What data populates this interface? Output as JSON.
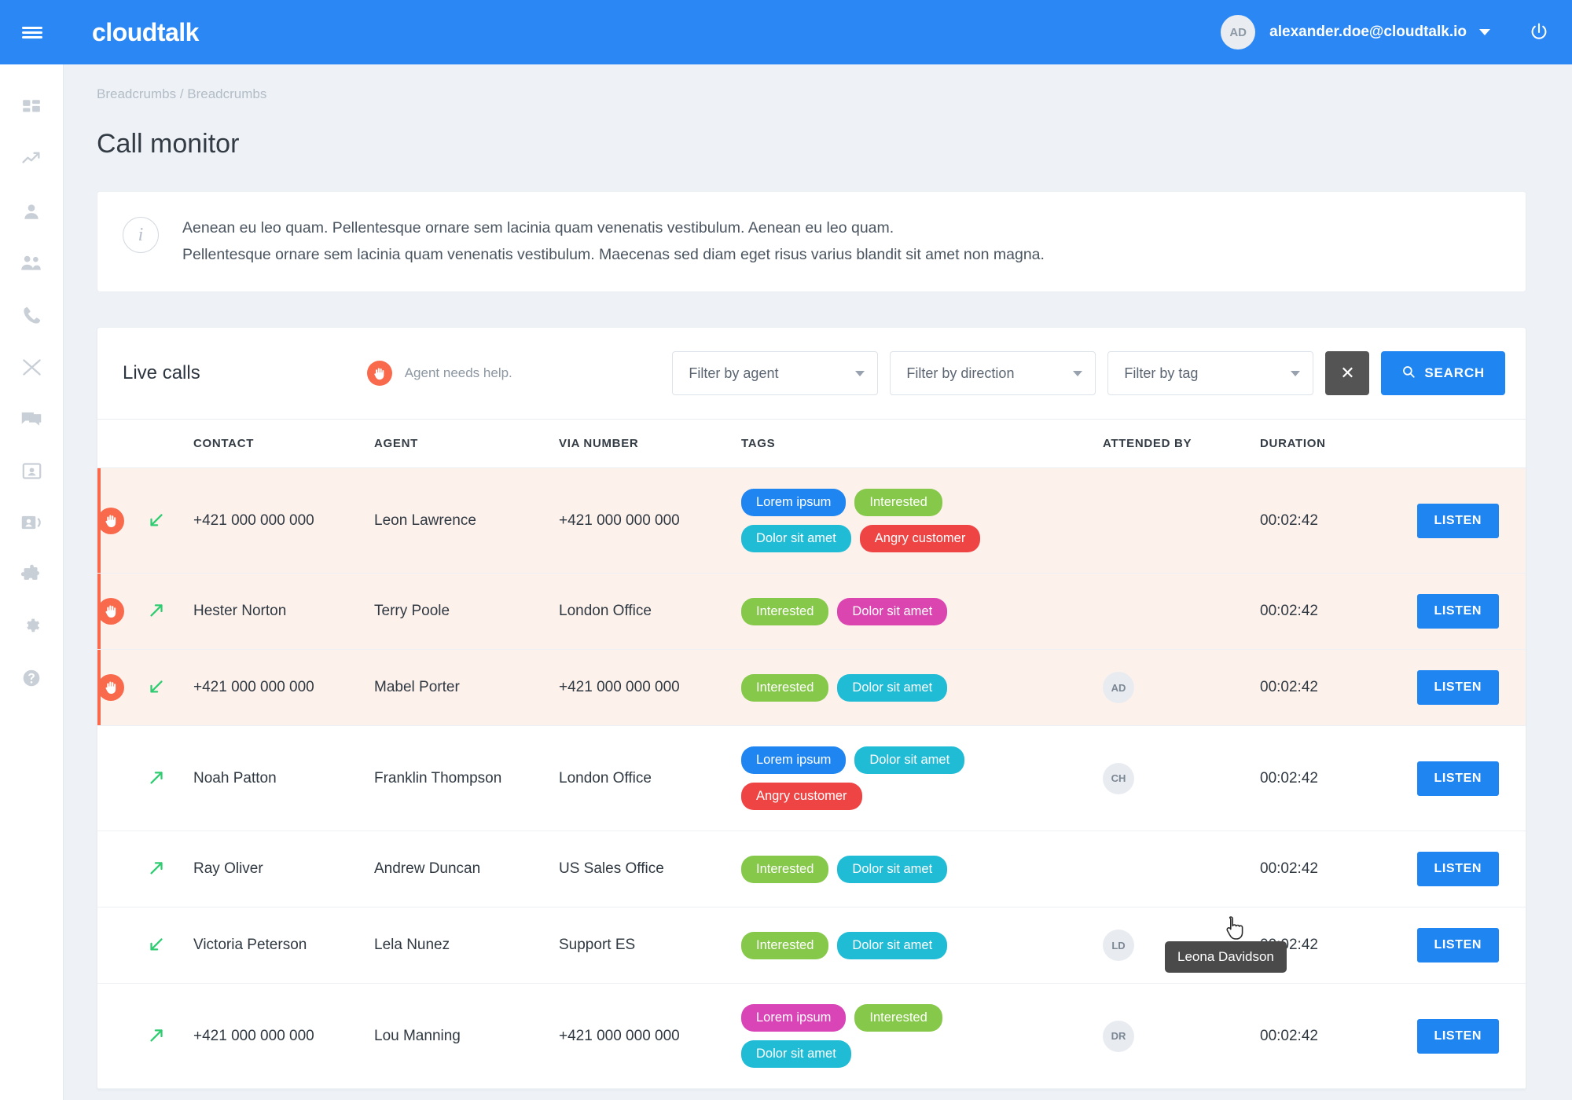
{
  "topbar": {
    "brand": "cloudtalk",
    "menu_icon": "hamburger-icon",
    "avatar_initials": "AD",
    "user_email": "alexander.doe@cloudtalk.io",
    "power_icon": "power-icon"
  },
  "sidebar": {
    "items": [
      {
        "name": "dashboard",
        "icon": "dashboard-icon"
      },
      {
        "name": "analytics",
        "icon": "trending-up-icon"
      },
      {
        "name": "agent",
        "icon": "person-icon"
      },
      {
        "name": "teams",
        "icon": "group-icon"
      },
      {
        "name": "calls",
        "icon": "phone-icon"
      },
      {
        "name": "routing",
        "icon": "shuffle-icon"
      },
      {
        "name": "messages",
        "icon": "chat-icon"
      },
      {
        "name": "contacts",
        "icon": "contact-card-icon"
      },
      {
        "name": "call-monitor",
        "icon": "id-card-icon"
      },
      {
        "name": "integrations",
        "icon": "puzzle-icon"
      },
      {
        "name": "settings",
        "icon": "gear-icon"
      },
      {
        "name": "help",
        "icon": "help-circle-icon"
      }
    ]
  },
  "breadcrumb": "Breadcrumbs / Breadcrumbs",
  "page_title": "Call monitor",
  "info_banner": {
    "icon": "info-icon",
    "line1": "Aenean eu leo quam. Pellentesque ornare sem lacinia quam venenatis vestibulum. Aenean eu leo quam.",
    "line2": "Pellentesque ornare sem lacinia quam venenatis vestibulum. Maecenas sed diam eget risus varius blandit sit amet non magna."
  },
  "toolbar": {
    "title": "Live calls",
    "help_icon": "raised-hand-icon",
    "help_text": "Agent needs help.",
    "filter_agent": "Filter by agent",
    "filter_direction": "Filter by direction",
    "filter_tag": "Filter by tag",
    "clear_label": "✕",
    "search_label": "SEARCH",
    "search_icon": "search-icon"
  },
  "table": {
    "headers": [
      "",
      "",
      "CONTACT",
      "AGENT",
      "VIA NUMBER",
      "TAGS",
      "ATTENDED BY",
      "DURATION",
      ""
    ],
    "action_label": "LISTEN",
    "rows": [
      {
        "alert": true,
        "direction": "inbound",
        "contact": "+421 000 000 000",
        "agent": "Leon Lawrence",
        "via": "+421 000 000 000",
        "tags": [
          {
            "label": "Lorem ipsum",
            "color": "t-blue"
          },
          {
            "label": "Interested",
            "color": "t-green"
          },
          {
            "label": "Dolor sit amet",
            "color": "t-cyan"
          },
          {
            "label": "Angry customer",
            "color": "t-red"
          }
        ],
        "attended_by": "",
        "duration": "00:02:42"
      },
      {
        "alert": true,
        "direction": "outbound",
        "contact": "Hester Norton",
        "agent": "Terry Poole",
        "via": "London Office",
        "tags": [
          {
            "label": "Interested",
            "color": "t-green"
          },
          {
            "label": "Dolor sit amet",
            "color": "t-magenta"
          }
        ],
        "attended_by": "",
        "duration": "00:02:42"
      },
      {
        "alert": true,
        "direction": "inbound",
        "contact": "+421 000 000 000",
        "agent": "Mabel Porter",
        "via": "+421 000 000 000",
        "tags": [
          {
            "label": "Interested",
            "color": "t-green"
          },
          {
            "label": "Dolor sit amet",
            "color": "t-cyan"
          }
        ],
        "attended_by": "AD",
        "duration": "00:02:42"
      },
      {
        "alert": false,
        "direction": "outbound",
        "contact": "Noah Patton",
        "agent": "Franklin Thompson",
        "via": "London Office",
        "tags": [
          {
            "label": "Lorem ipsum",
            "color": "t-blue"
          },
          {
            "label": "Dolor sit amet",
            "color": "t-cyan"
          },
          {
            "label": "Angry customer",
            "color": "t-red"
          }
        ],
        "attended_by": "CH",
        "duration": "00:02:42"
      },
      {
        "alert": false,
        "direction": "outbound",
        "contact": "Ray Oliver",
        "agent": "Andrew Duncan",
        "via": "US Sales Office",
        "tags": [
          {
            "label": "Interested",
            "color": "t-green"
          },
          {
            "label": "Dolor sit amet",
            "color": "t-cyan"
          }
        ],
        "attended_by": "",
        "duration": "00:02:42"
      },
      {
        "alert": false,
        "direction": "inbound",
        "contact": "Victoria Peterson",
        "agent": "Lela Nunez",
        "via": "Support ES",
        "tags": [
          {
            "label": "Interested",
            "color": "t-green"
          },
          {
            "label": "Dolor sit amet",
            "color": "t-cyan"
          }
        ],
        "attended_by": "LD",
        "duration": "00:02:42"
      },
      {
        "alert": false,
        "direction": "outbound",
        "contact": "+421 000 000 000",
        "agent": "Lou Manning",
        "via": "+421 000 000 000",
        "tags": [
          {
            "label": "Lorem ipsum",
            "color": "t-pink"
          },
          {
            "label": "Interested",
            "color": "t-green"
          },
          {
            "label": "Dolor sit amet",
            "color": "t-cyan"
          }
        ],
        "attended_by": "DR",
        "duration": "00:02:42"
      }
    ]
  },
  "tooltip": {
    "text": "Leona Davidson"
  },
  "colors": {
    "brand_blue": "#2b87f3",
    "accent_blue": "#1f85f0",
    "alert_orange": "#f96a4d",
    "alert_row_bg": "#fdf1ec",
    "tag_green": "#86c94a",
    "tag_cyan": "#20bcd6",
    "tag_red": "#ef4444",
    "tag_pink": "#d945b6",
    "page_bg": "#eef2f6"
  }
}
